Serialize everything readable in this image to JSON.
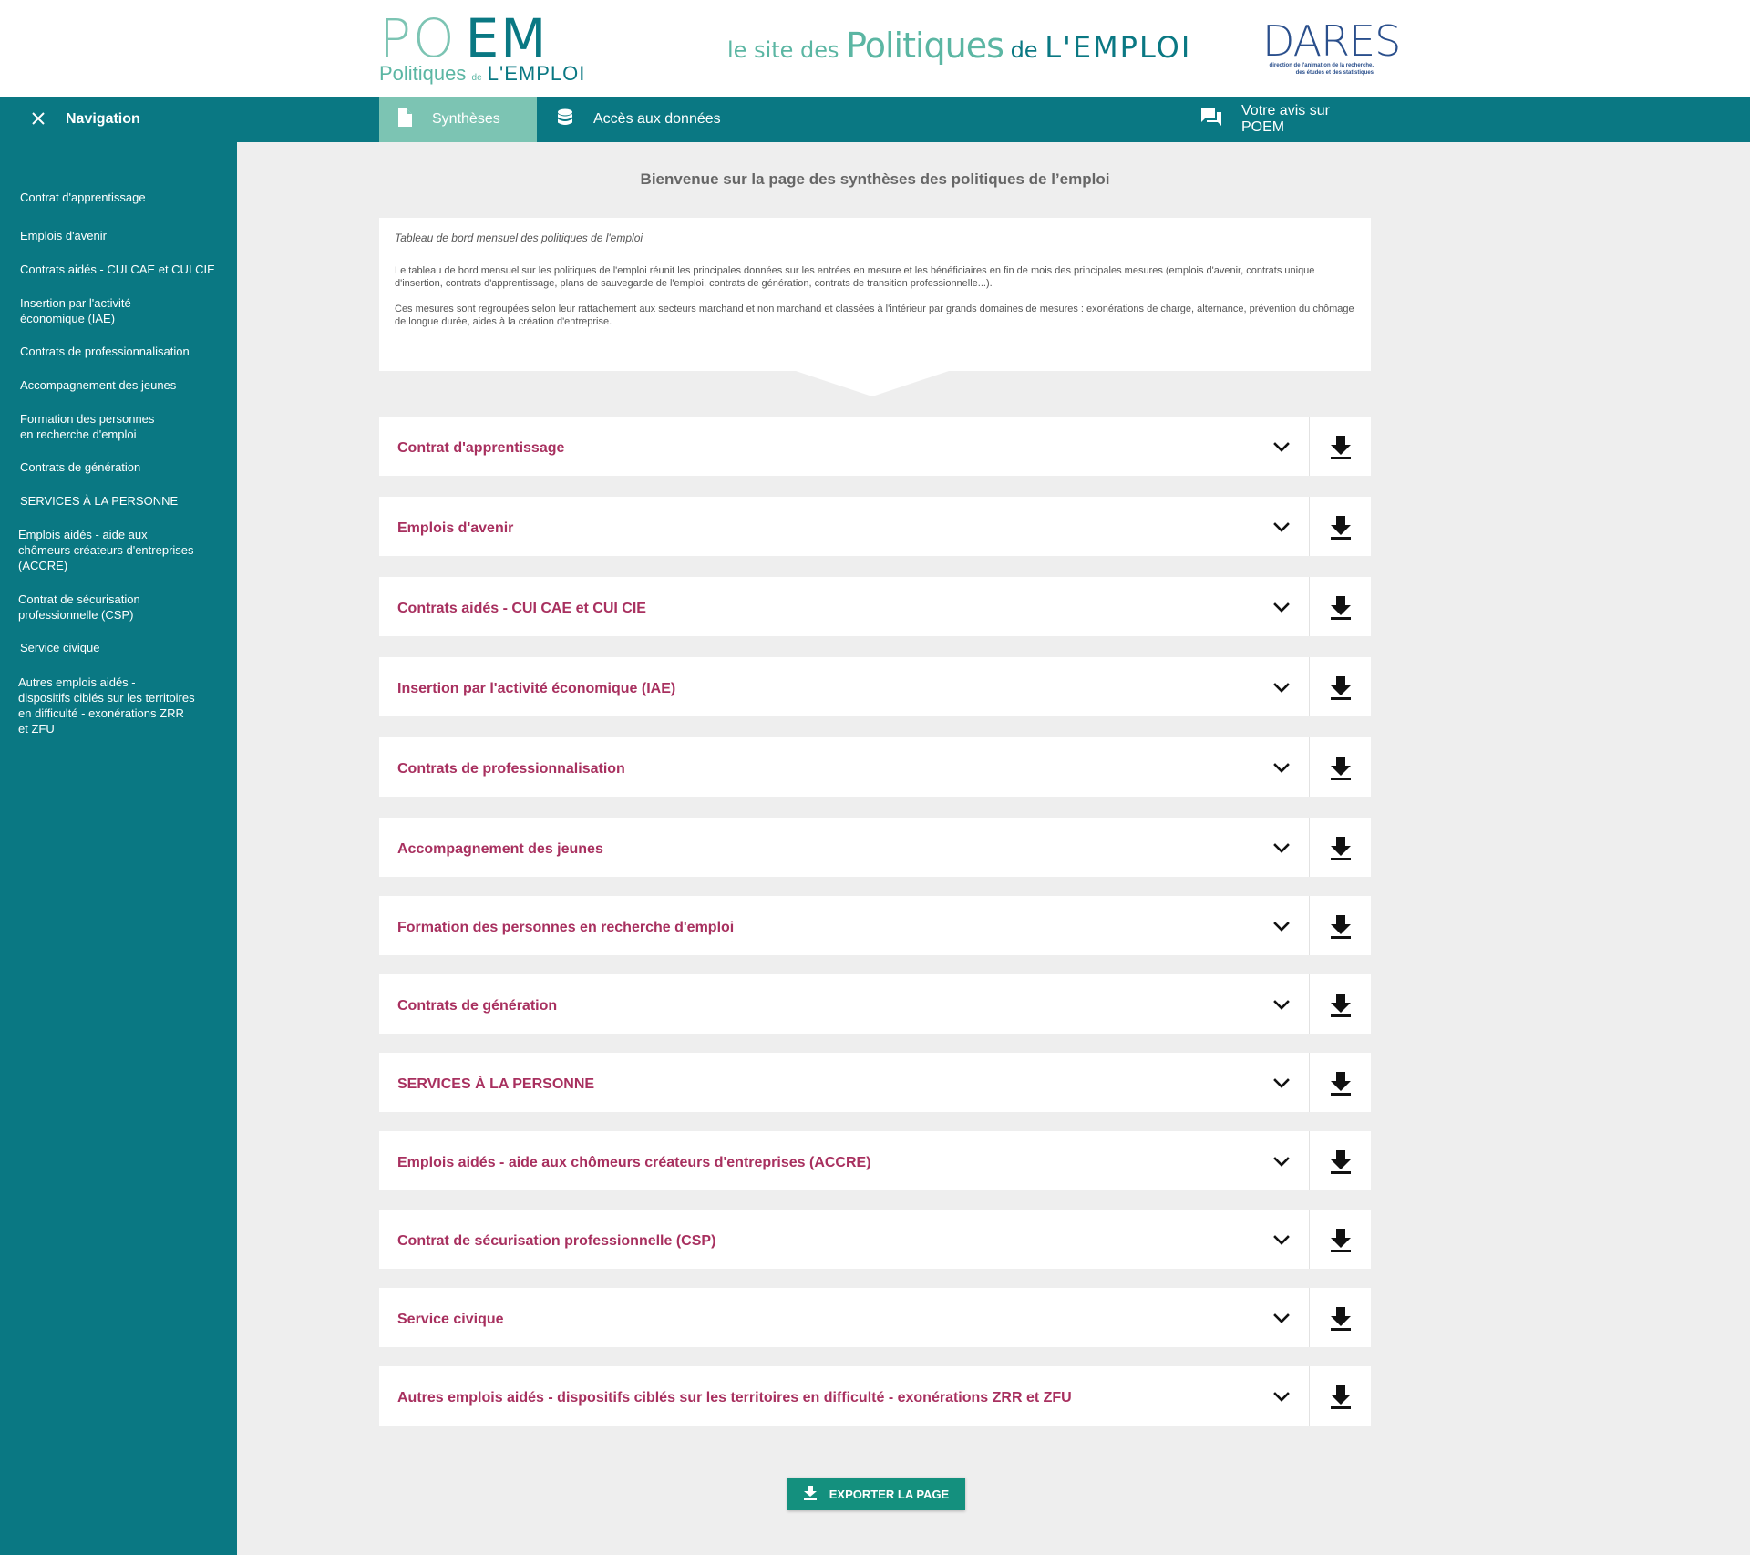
{
  "header": {
    "logo": {
      "line1_a": "PO",
      "line1_b": "EM",
      "line2_a": "Politiques",
      "line2_b": "de",
      "line2_c": "L'EMPLOI"
    },
    "tagline": {
      "t1": "le site des ",
      "t2": "Politiques",
      "t3": " de ",
      "t4": "L'EMPLOI"
    },
    "dares": {
      "word": "DARES",
      "sub1": "direction de l'animation de la recherche,",
      "sub2": "des études et des statistiques"
    }
  },
  "nav": {
    "toggle_label": "Navigation",
    "tabs": [
      {
        "label": "Synthèses",
        "icon": "document-icon",
        "active": true
      },
      {
        "label": "Accès aux données",
        "icon": "database-icon",
        "active": false
      },
      {
        "label": "Votre avis sur POEM",
        "icon": "chat-icon",
        "active": false
      }
    ]
  },
  "sidebar": {
    "items": [
      "Contrat d'apprentissage",
      "Emplois d'avenir",
      "Contrats aidés - CUI CAE et CUI CIE",
      "Insertion par l'activité\néconomique (IAE)",
      "Contrats de professionnalisation",
      "Accompagnement des jeunes",
      "Formation des personnes\nen recherche d'emploi",
      "Contrats de génération",
      "SERVICES À LA PERSONNE",
      "Emplois aidés - aide aux\nchômeurs créateurs d'entreprises\n (ACCRE)",
      "Contrat de sécurisation\n professionnelle (CSP)",
      "Service civique",
      "Autres emplois aidés -\ndispositifs ciblés sur les territoires\nen difficulté - exonérations ZRR\net ZFU"
    ]
  },
  "main": {
    "welcome": "Bienvenue sur la page des synthèses des politiques de l’emploi",
    "intro": {
      "title": "Tableau de bord mensuel des politiques de l'emploi",
      "p1": "Le tableau de bord mensuel sur les politiques de l'emploi réunit les principales données sur les entrées en mesure et les bénéficiaires en fin de mois des principales mesures (emplois d'avenir, contrats unique d'insertion, contrats d'apprentissage, plans de sauvegarde de l'emploi, contrats de génération, contrats de transition professionnelle...).",
      "p2": "Ces mesures sont regroupées selon leur rattachement aux secteurs marchand et non marchand et classées à l'intérieur par grands domaines de mesures : exonérations de charge, alternance, prévention du chômage de longue durée, aides à la création d'entreprise."
    },
    "accordions": [
      "Contrat d'apprentissage",
      "Emplois d'avenir",
      "Contrats aidés - CUI CAE et CUI CIE",
      "Insertion par l'activité économique (IAE)",
      "Contrats de professionnalisation",
      "Accompagnement des jeunes",
      "Formation des personnes en recherche d'emploi",
      "Contrats de génération",
      "SERVICES À LA PERSONNE",
      "Emplois aidés - aide aux chômeurs créateurs d'entreprises (ACCRE)",
      "Contrat de sécurisation professionnelle (CSP)",
      "Service civique",
      "Autres emplois aidés - dispositifs ciblés sur les territoires en difficulté - exonérations ZRR et ZFU"
    ],
    "export_label": "EXPORTER LA PAGE"
  },
  "colors": {
    "teal": "#0a7883",
    "light_teal": "#7cc4b3",
    "accordion_title": "#a8305f",
    "export_button": "#14907e",
    "background": "#eeeeee"
  }
}
